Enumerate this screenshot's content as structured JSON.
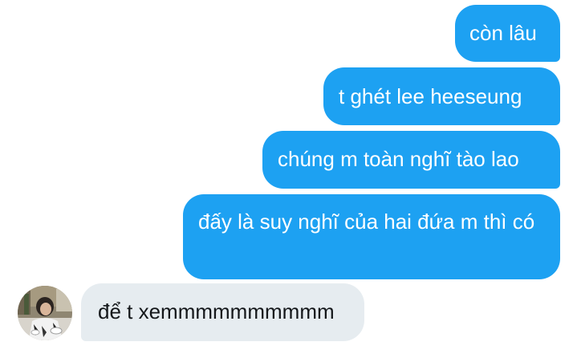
{
  "messages": [
    {
      "direction": "outgoing",
      "text": "còn lâu"
    },
    {
      "direction": "outgoing",
      "text": "t ghét lee heeseung"
    },
    {
      "direction": "outgoing",
      "text": "chúng m toàn nghĩ tào lao"
    },
    {
      "direction": "outgoing",
      "text": "đấy là suy nghĩ của hai đứa m thì có"
    },
    {
      "direction": "incoming",
      "text": "để t xemmmmmmmmmm"
    }
  ],
  "colors": {
    "outgoing_bubble": "#1da1f2",
    "incoming_bubble": "#e6ecf0",
    "outgoing_text": "#ffffff",
    "incoming_text": "#14171a"
  }
}
